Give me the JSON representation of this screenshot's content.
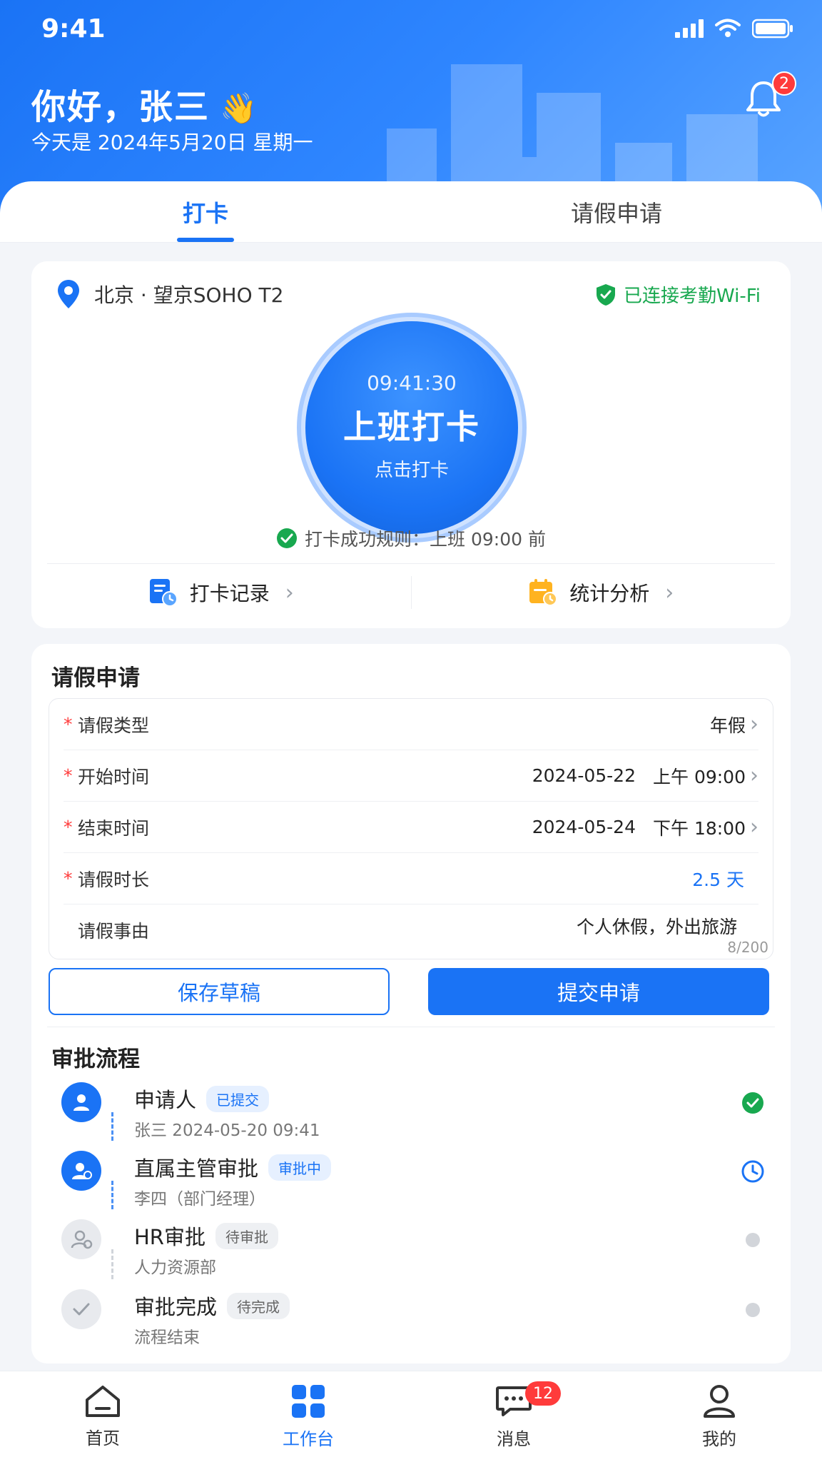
{
  "status_bar": {
    "time": "9:41"
  },
  "header": {
    "greeting": "你好，张三",
    "wave": "👋",
    "date_line": "今天是 2024年5月20日 星期一",
    "notification_count": "2"
  },
  "tabs": [
    {
      "label": "打卡"
    },
    {
      "label": "请假申请"
    }
  ],
  "checkin": {
    "location": "北京 · 望京SOHO T2",
    "wifi_status": "已连接考勤Wi-Fi",
    "punch_time": "09:41:30",
    "punch_label": "上班打卡",
    "punch_hint": "点击打卡",
    "rule": "打卡成功规则：上班 09:00 前",
    "quick_links": [
      {
        "label": "打卡记录"
      },
      {
        "label": "统计分析"
      }
    ]
  },
  "leave": {
    "title": "请假申请",
    "fields": [
      {
        "label": "请假类型",
        "value": "年假"
      },
      {
        "label": "开始时间",
        "date": "2024-05-22",
        "time": "上午 09:00"
      },
      {
        "label": "结束时间",
        "date": "2024-05-24",
        "time": "下午 18:00"
      },
      {
        "label": "请假时长",
        "value": "2.5 天"
      },
      {
        "label": "请假事由",
        "value": "个人休假，外出旅游"
      }
    ],
    "counter": "8/200",
    "save_label": "保存草稿",
    "submit_label": "提交申请"
  },
  "approval": {
    "title": "审批流程",
    "steps": [
      {
        "name": "申请人",
        "tag": "已提交",
        "sub": "张三   2024-05-20 09:41"
      },
      {
        "name": "直属主管审批",
        "tag": "审批中",
        "sub": "李四（部门经理）"
      },
      {
        "name": "HR审批",
        "tag": "待审批",
        "sub": "人力资源部"
      },
      {
        "name": "审批完成",
        "tag": "待完成",
        "sub": "流程结束"
      }
    ]
  },
  "bottom_nav": {
    "items": [
      {
        "label": "首页"
      },
      {
        "label": "工作台"
      },
      {
        "label": "消息"
      },
      {
        "label": "我的"
      }
    ],
    "message_badge": "12"
  },
  "colors": {
    "primary": "#1a73f5",
    "success": "#18a84f",
    "danger": "#ff3b3b"
  }
}
